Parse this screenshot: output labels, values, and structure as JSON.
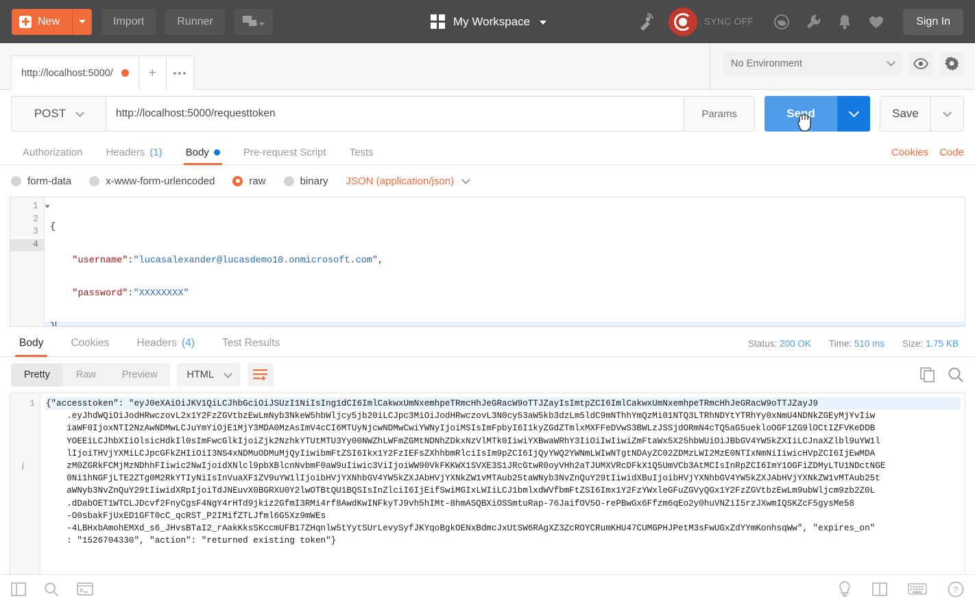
{
  "topbar": {
    "new_label": "New",
    "import_label": "Import",
    "runner_label": "Runner",
    "workspace_label": "My Workspace",
    "sync_label": "SYNC OFF",
    "signin_label": "Sign In",
    "icons": [
      "satellite-icon",
      "sync-status-icon",
      "globe-icon",
      "wrench-icon",
      "bell-icon",
      "heart-icon"
    ],
    "accent_orange": "#f26b3a",
    "bar_bg": "#4a4a4a"
  },
  "tabstrip": {
    "request_tab_title": "http://localhost:5000/",
    "new_tab_label": "+",
    "environment": {
      "selected": "No Environment",
      "eye_icon": "eye-icon",
      "gear_icon": "gear-icon"
    }
  },
  "url_row": {
    "method": "POST",
    "url": "http://localhost:5000/requesttoken",
    "params_label": "Params",
    "send_label": "Send",
    "save_label": "Save"
  },
  "request_tabs": {
    "items": [
      {
        "label": "Authorization",
        "active": false
      },
      {
        "label": "Headers",
        "count": "(1)",
        "active": false
      },
      {
        "label": "Body",
        "active": true,
        "dot": true
      },
      {
        "label": "Pre-request Script",
        "active": false
      },
      {
        "label": "Tests",
        "active": false
      }
    ],
    "right_links": [
      "Cookies",
      "Code"
    ]
  },
  "body_type": {
    "options": [
      {
        "label": "form-data",
        "selected": false
      },
      {
        "label": "x-www-form-urlencoded",
        "selected": false
      },
      {
        "label": "raw",
        "selected": true
      },
      {
        "label": "binary",
        "selected": false
      }
    ],
    "format": "JSON (application/json)"
  },
  "request_body": {
    "line_numbers": [
      "1",
      "2",
      "3",
      "4"
    ],
    "lines": [
      {
        "segments": [
          {
            "t": "{",
            "c": "pun"
          }
        ]
      },
      {
        "segments": [
          {
            "t": "    \"username\"",
            "c": "key"
          },
          {
            "t": ":",
            "c": "pun"
          },
          {
            "t": "\"lucasalexander@lucasdemo10.onmicrosoft.com\"",
            "c": "str"
          },
          {
            "t": ",",
            "c": "pun"
          }
        ]
      },
      {
        "segments": [
          {
            "t": "    \"password\"",
            "c": "key"
          },
          {
            "t": ":",
            "c": "pun"
          },
          {
            "t": "\"XXXXXXXX\"",
            "c": "str"
          }
        ]
      },
      {
        "segments": [
          {
            "t": "}",
            "c": "pun"
          }
        ]
      }
    ]
  },
  "response_tabs": {
    "items": [
      {
        "label": "Body",
        "active": true
      },
      {
        "label": "Cookies",
        "active": false
      },
      {
        "label": "Headers",
        "count": "(4)",
        "active": false
      },
      {
        "label": "Test Results",
        "active": false
      }
    ],
    "meta": {
      "status_label": "Status:",
      "status_value": "200 OK",
      "time_label": "Time:",
      "time_value": "510 ms",
      "size_label": "Size:",
      "size_value": "1.75 KB"
    }
  },
  "response_toolbar": {
    "view_modes": [
      {
        "label": "Pretty",
        "active": true
      },
      {
        "label": "Raw",
        "active": false
      },
      {
        "label": "Preview",
        "active": false
      }
    ],
    "format": "HTML",
    "wrap_icon": "word-wrap-icon",
    "copy_icon": "copy-icon",
    "search_icon": "search-icon"
  },
  "response_body": {
    "line_number": "1",
    "info_icon": "info-icon",
    "lines": [
      "{\"accesstoken\": \"eyJ0eXAiOiJKV1QiLCJhbGciOiJSUzI1NiIsIng1dCI6ImlCakwxUmNxemhpeTRmcHhJeGRacW9oTTJZayIsImtpZCI6ImlCakwxUmNxemhpeTRmcHhJeGRacW9oTTJZayJ9",
      "    .eyJhdWQiOiJodHRwczovL2x1Y2FzZGVtbzEwLmNyb3NkeW5hbWljcy5jb20iLCJpc3MiOiJodHRwczovL3N0cy53aW5kb3dzLm5ldC9mNThhYmQzMi01NTQ3LTRhNDYtYTRhYy0xNmU4NDNkZGEyMjYvIiw",
      "    iaWF0IjoxNTI2NzAwNDMwLCJuYmYiOjE1MjY3MDA0MzAsImV4cCI6MTUyNjcwNDMwCwiYWNyIjoiMSIsImFpbyI6I1kyZGdZTmlxMXFFeDVwS3BWLzJSSjdORmN4cTQ5aG5uekloOGF1ZG9lOCtIZFVKeDDB",
      "    YOEEiLCJhbXIiOlsicHdkIl0sImFwcGlkIjoiZjk2NzhkYTUtMTU3Yy00NWZhLWFmZGMtNDNhZDkxNzVlMTk0IiwiYXBwaWRhY3IiOiIwIiwiZmFtaWx5X25hbWUiOiJBbGV4YW5kZXIiLCJnaXZlbl9uYW1l",
      "    lIjoiTHVjYXMiLCJpcGFkZHIiOiI3NS4xNDMuODMuMjQyIiwibmFtZSI6Ikx1Y2FzIEFsZXhhbmRlciIsIm9pZCI6IjQyYWQ2YWNmLWIwNTgtNDAyZC02ZDMzLWI2MzE0NTIxNmNiIiwicHVpZCI6IjEwMDA",
      "    zM0ZGRkFCMjMzNDhhFIiwic2NwIjoidXNlcl9pbXBlcnNvbmF0aW9uIiwic3ViIjoiWW90VkFKKWX1SVXE3S1JRcGtwR0oyVHh2aTJUMXVRcDFkX1Q5UmVCb3AtMCIsInRpZCI6ImY1OGFiZDMyLTU1NDctNGE",
      "    0Ni1hNGFjLTE2ZTg0M2RkYTIyNiIsInVuaXF1ZV9uYW1lIjoibHVjYXNhbGV4YW5kZXJAbHVjYXNkZW1vMTAub25taWNyb3NvZnQuY29tIiwidXBuIjoibHVjYXNhbGV4YW5kZXJAbHVjYXNkZW1vMTAub25t",
      "    aWNyb3NvZnQuY29tIiwidXRpIjoiTdJNEuvX0BGRXU0Y2lwOTBtQU1BQSIsInZlciI6IjEifSwiMGIxLWIiLCJ1bmlxdWVfbmFtZSI6Imx1Y2FzYWxleGFuZGVyQGx1Y2FzZGVtbzEwLm9ubWljcm9zb2Z0L",
      "    .dDabOET1WTCLJDcvf2FnyCgsF4NgY4rHTd9jkiz2GfmI3RMi4rf8AwdKwINFkyTJ9vh5hIMt-8hmASQBXiOSSmtuRap-76JaifOV5O-rePBwGx6Ffzm6qEo2y0huVNZiI5rzJXwmIQSKZcF5gysMe58",
      "    -O0sbakFjUxED1GFT0cC_qcRST_P2IMifZTLJfml6G5Xz9mWEs",
      "    -4LBHxbAmohEMXd_s6_JHvsBTaI2_rAakKksSKccmUFB17ZHqnlw5tYytSUrLevySyfJKYqoBgkOENxBdmcJxUtSW6RAgXZ3ZcROYCRumKHU47CUMGPHJPetM3sFwUGxZdYYmKonhsqWw\", \"expires_on\"",
      "    : \"1526704330\", \"action\": \"returned existing token\"}"
    ]
  },
  "status_bar": {
    "left_icons": [
      "sidebar-toggle-icon",
      "search-icon",
      "console-icon"
    ],
    "right_icons": [
      "bulb-icon",
      "two-pane-icon",
      "keyboard-icon",
      "help-icon"
    ]
  }
}
